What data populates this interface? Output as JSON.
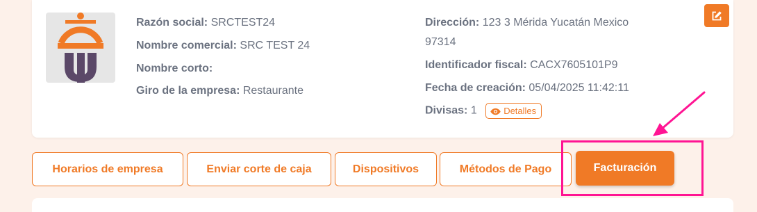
{
  "company": {
    "left_fields": [
      {
        "label": "Razón social:",
        "value": "SRCTEST24"
      },
      {
        "label": "Nombre comercial:",
        "value": "SRC TEST 24"
      },
      {
        "label": "Nombre corto:",
        "value": ""
      },
      {
        "label": "Giro de la empresa:",
        "value": "Restaurante"
      }
    ],
    "address": {
      "label": "Dirección:",
      "value_line1": "123 3 Mérida Yucatán Mexico",
      "value_line2": "97314"
    },
    "fiscal_id": {
      "label": "Identificador fiscal:",
      "value": "CACX7605101P9"
    },
    "created": {
      "label": "Fecha de creación:",
      "value": "05/04/2025 11:42:11"
    },
    "currencies": {
      "label": "Divisas:",
      "value": "1",
      "details_label": "Detalles"
    }
  },
  "tabs": [
    {
      "label": "Horarios de empresa",
      "active": false
    },
    {
      "label": "Enviar corte de caja",
      "active": false
    },
    {
      "label": "Dispositivos",
      "active": false
    },
    {
      "label": "Métodos de Pago",
      "active": false
    },
    {
      "label": "Facturación",
      "active": true
    }
  ],
  "icons": {
    "logo": "company-logo",
    "edit": "edit-icon",
    "details": "eye-icon"
  },
  "colors": {
    "accent": "#f07a26",
    "annotation": "#ff1493",
    "logo_purple": "#5b4868",
    "background": "#fdf1ea"
  }
}
